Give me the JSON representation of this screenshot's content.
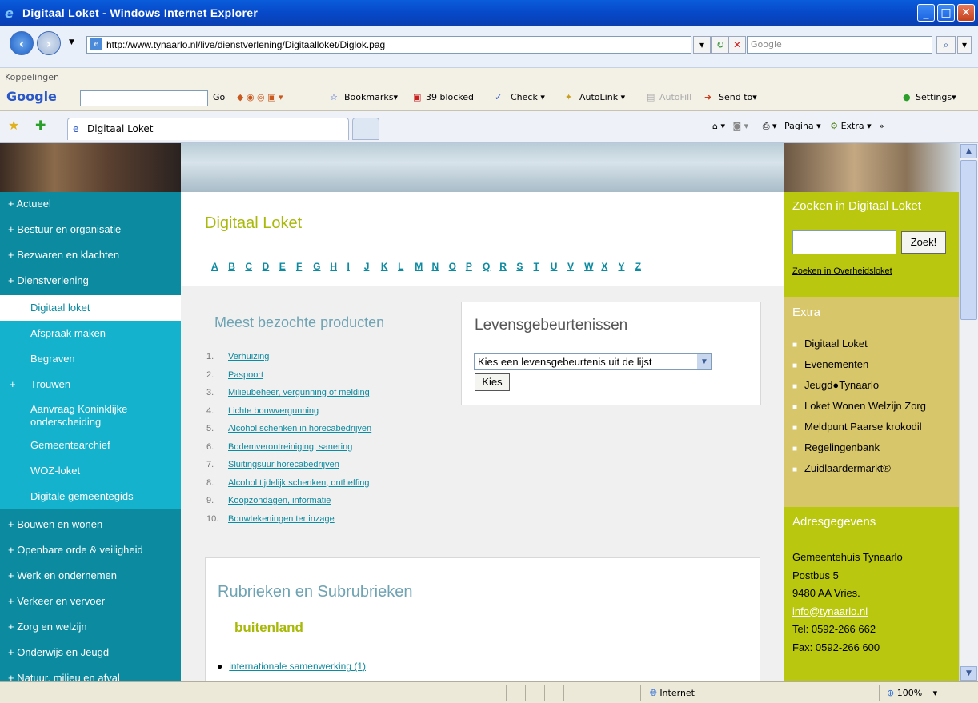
{
  "window": {
    "title": "Digitaal Loket - Windows Internet Explorer",
    "controls": [
      "_",
      "□",
      "✕"
    ]
  },
  "address": {
    "url": "http://www.tynaarlo.nl/live/dienstverlening/Digitaalloket/Diglok.pag",
    "search_placeholder": "Google"
  },
  "links_bar": {
    "label": "Koppelingen",
    "google_logo": "Google",
    "go": "Go",
    "bookmarks": "Bookmarks▾",
    "blocked": "39 blocked",
    "check": "Check ▾",
    "autolink": "AutoLink ▾",
    "autofill": "AutoFill",
    "send_to": "Send to▾",
    "settings": "Settings▾"
  },
  "tabs": {
    "active_tab": "Digitaal Loket",
    "tools_pagina": "Pagina ▾",
    "tools_extra": "Extra ▾"
  },
  "left_nav": [
    {
      "label": "+ Actueel",
      "sub": false,
      "active": false
    },
    {
      "label": "+ Bestuur en organisatie",
      "sub": false,
      "active": false
    },
    {
      "label": "+ Bezwaren en klachten",
      "sub": false,
      "active": false
    },
    {
      "label": "+ Dienstverlening",
      "sub": false,
      "active": false
    },
    {
      "label": "Digitaal loket",
      "sub": true,
      "active": true
    },
    {
      "label": "Afspraak maken",
      "sub": true,
      "active": false
    },
    {
      "label": "Begraven",
      "sub": true,
      "active": false
    },
    {
      "label": "Trouwen",
      "sub": true,
      "active": false,
      "plus": "+"
    },
    {
      "label": "Aanvraag Koninklijke onderscheiding",
      "sub": true,
      "active": false
    },
    {
      "label": "Gemeentearchief",
      "sub": true,
      "active": false
    },
    {
      "label": "WOZ-loket",
      "sub": true,
      "active": false
    },
    {
      "label": "Digitale gemeentegids",
      "sub": true,
      "active": false
    },
    {
      "label": "+ Bouwen en wonen",
      "sub": false,
      "active": false
    },
    {
      "label": "+ Openbare orde & veiligheid",
      "sub": false,
      "active": false
    },
    {
      "label": "+ Werk en ondernemen",
      "sub": false,
      "active": false
    },
    {
      "label": "+ Verkeer en vervoer",
      "sub": false,
      "active": false
    },
    {
      "label": "+ Zorg en welzijn",
      "sub": false,
      "active": false
    },
    {
      "label": "+ Onderwijs en Jeugd",
      "sub": false,
      "active": false
    },
    {
      "label": "+ Natuur, milieu en afval",
      "sub": false,
      "active": false
    }
  ],
  "main": {
    "title": "Digitaal Loket",
    "alphabet": [
      "A",
      "B",
      "C",
      "D",
      "E",
      "F",
      "G",
      "H",
      "I",
      "J",
      "K",
      "L",
      "M",
      "N",
      "O",
      "P",
      "Q",
      "R",
      "S",
      "T",
      "U",
      "V",
      "W",
      "X",
      "Y",
      "Z"
    ],
    "popular_title": "Meest bezochte producten",
    "popular": [
      "Verhuizing",
      "Paspoort",
      "Milieubeheer, vergunning of melding",
      "Lichte bouwvergunning",
      "Alcohol schenken in horecabedrijven",
      "Bodemverontreiniging, sanering",
      "Sluitingsuur horecabedrijven",
      "Alcohol tijdelijk schenken, ontheffing",
      "Koopzondagen, informatie",
      "Bouwtekeningen ter inzage"
    ],
    "life_events_title": "Levensgebeurtenissen",
    "life_events_select": "Kies een levensgebeurtenis uit de lijst",
    "life_events_button": "Kies",
    "rubrieken_title": "Rubrieken en Subrubrieken",
    "rubrieken_sub": "buitenland",
    "rubrieken_link": "internationale samenwerking (1)"
  },
  "right": {
    "search_title": "Zoeken in Digitaal Loket",
    "search_button": "Zoek!",
    "overheid_link": "Zoeken in Overheidsloket",
    "extra_title": "Extra",
    "extra_items": [
      "Digitaal Loket",
      "Evenementen",
      "Jeugd●Tynaarlo",
      "Loket Wonen Welzijn Zorg",
      "Meldpunt Paarse krokodil",
      "Regelingenbank",
      "Zuidlaardermarkt®"
    ],
    "address_title": "Adresgegevens",
    "address_lines": [
      "Gemeentehuis Tynaarlo",
      "Postbus 5",
      "9480 AA Vries.",
      "info@tynaarlo.nl",
      "Tel: 0592-266 662",
      "Fax: 0592-266 600"
    ]
  },
  "status": {
    "zone": "Internet",
    "zoom": "100%"
  },
  "colors": {
    "teal_nav": "#0b8aa0",
    "teal_sub": "#14b2cc",
    "lime": "#b9c80e",
    "mustard": "#d7c66a",
    "title_green": "#a8b90a"
  }
}
